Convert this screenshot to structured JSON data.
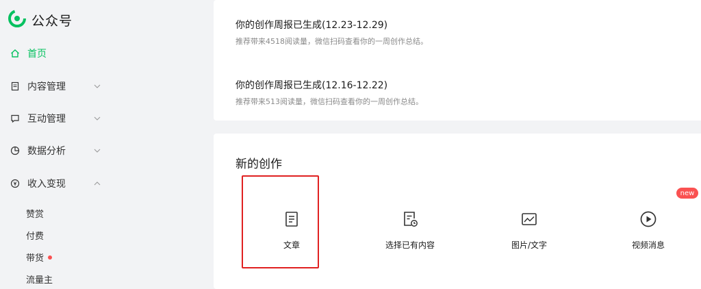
{
  "app": {
    "title": "公众号",
    "brand_color": "#07c160"
  },
  "sidebar": {
    "items": [
      {
        "label": "首页",
        "icon": "home-icon",
        "active": true
      },
      {
        "label": "内容管理",
        "icon": "document-icon",
        "expanded": false
      },
      {
        "label": "互动管理",
        "icon": "comment-icon",
        "expanded": false
      },
      {
        "label": "数据分析",
        "icon": "pie-chart-icon",
        "expanded": false
      },
      {
        "label": "收入变现",
        "icon": "yen-icon",
        "expanded": true
      }
    ],
    "sub_items": [
      {
        "label": "赞赏"
      },
      {
        "label": "付费"
      },
      {
        "label": "带货",
        "dot": true
      },
      {
        "label": "流量主"
      }
    ]
  },
  "reports": [
    {
      "title": "你的创作周报已生成(12.23-12.29)",
      "desc": "推荐带来4518阅读量，微信扫码查看你的一周创作总结。"
    },
    {
      "title": "你的创作周报已生成(12.16-12.22)",
      "desc": "推荐带来513阅读量，微信扫码查看你的一周创作总结。"
    }
  ],
  "new_creation": {
    "title": "新的创作",
    "items": [
      {
        "label": "文章",
        "icon": "article-icon"
      },
      {
        "label": "选择已有内容",
        "icon": "existing-content-icon"
      },
      {
        "label": "图片/文字",
        "icon": "image-text-icon"
      },
      {
        "label": "视频消息",
        "icon": "video-play-icon"
      }
    ],
    "new_badge": "new"
  }
}
